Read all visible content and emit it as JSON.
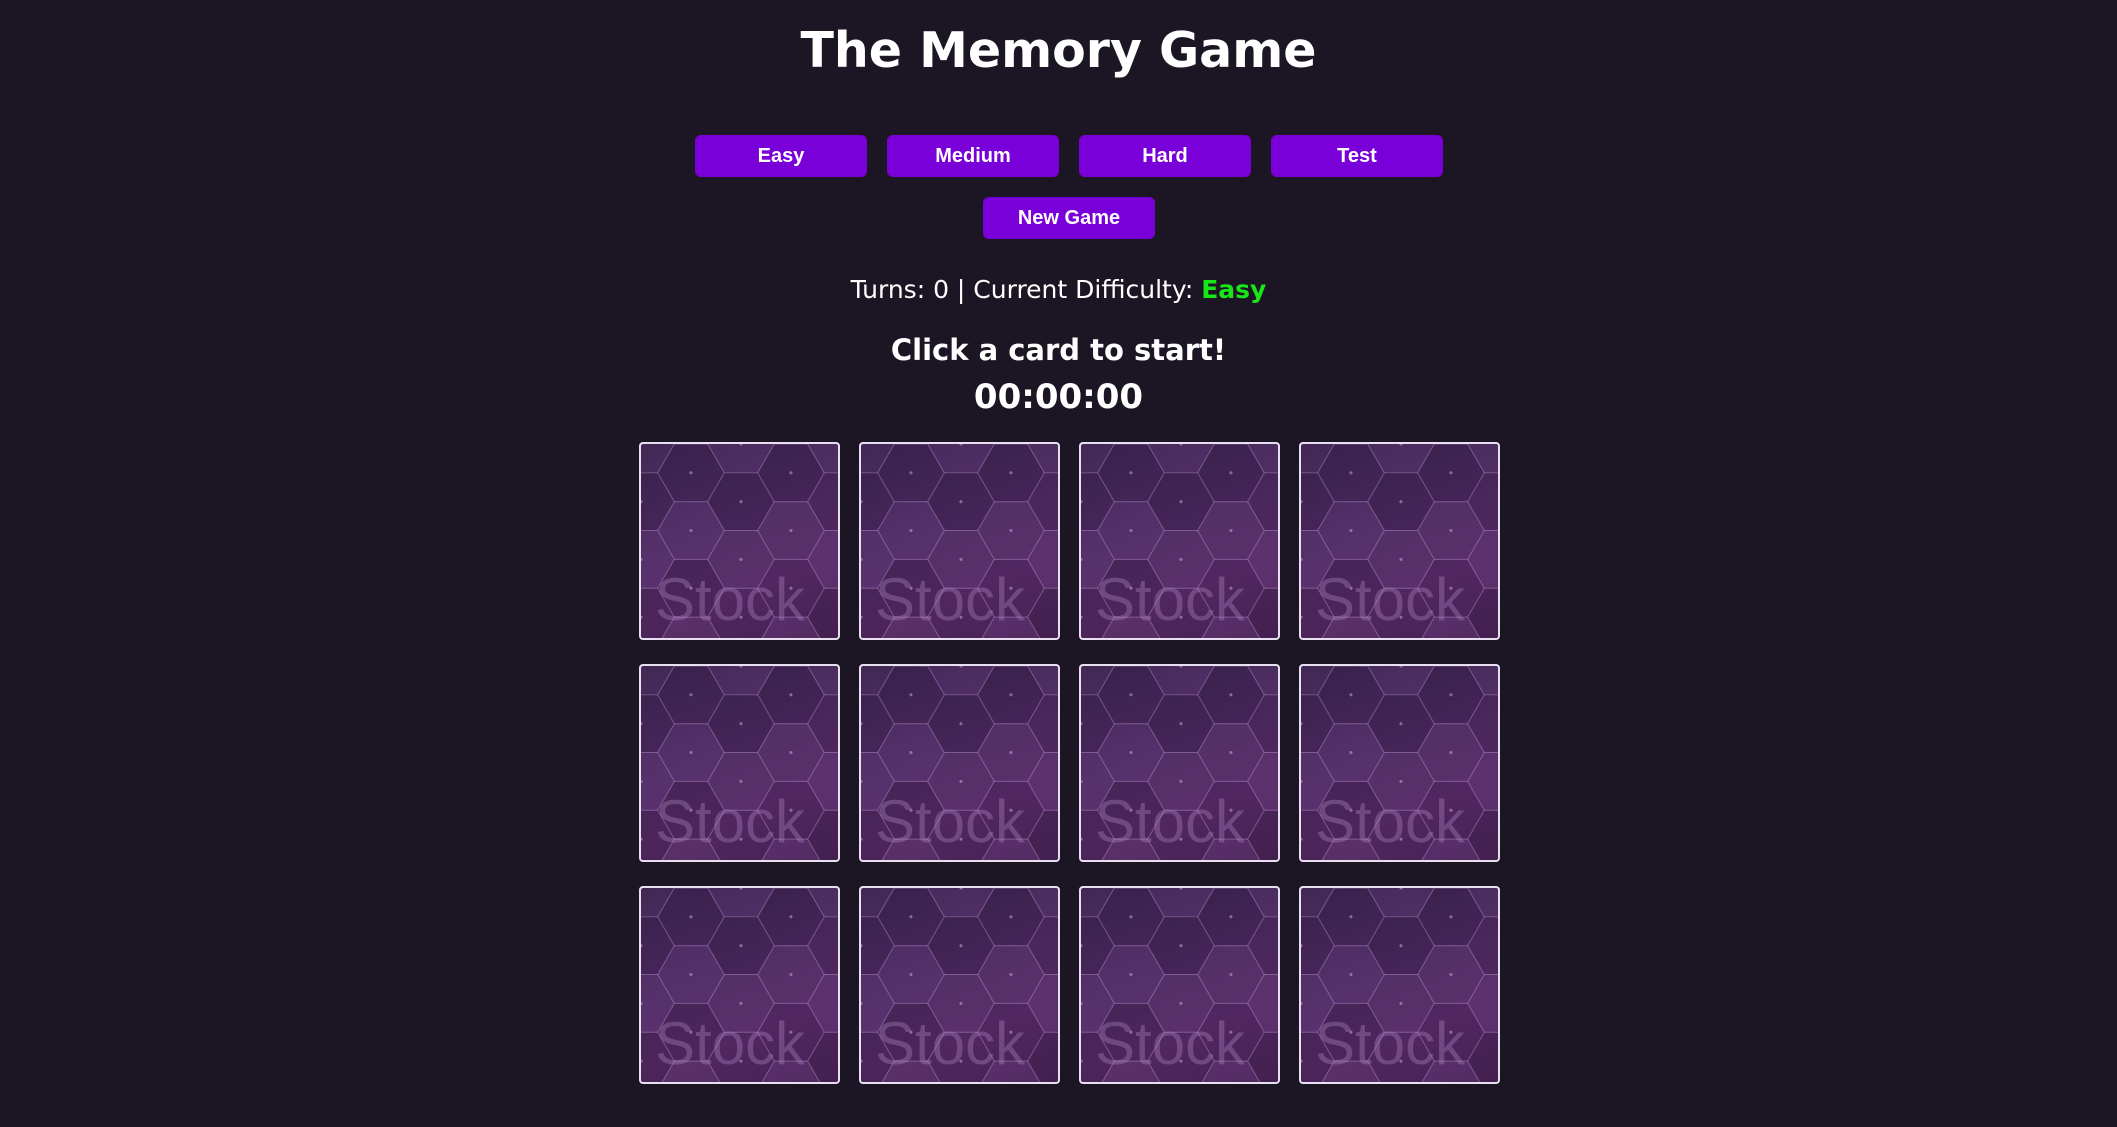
{
  "title": "The Memory Game",
  "difficulty_buttons": [
    {
      "label": "Easy"
    },
    {
      "label": "Medium"
    },
    {
      "label": "Hard"
    },
    {
      "label": "Test"
    }
  ],
  "new_game_label": "New Game",
  "status": {
    "turns_prefix": "Turns: ",
    "turns": "0",
    "separator": " | Current Difficulty: ",
    "difficulty": "Easy"
  },
  "prompt": "Click a card to start!",
  "timer": "00:00:00",
  "cards": {
    "count": 12,
    "back_watermark": "Stock",
    "back_icon": "hexagon-pattern"
  },
  "colors": {
    "background": "#1c1624",
    "button": "#7a00d9",
    "difficulty": "#19e619",
    "card_border": "#e8e0f0"
  }
}
